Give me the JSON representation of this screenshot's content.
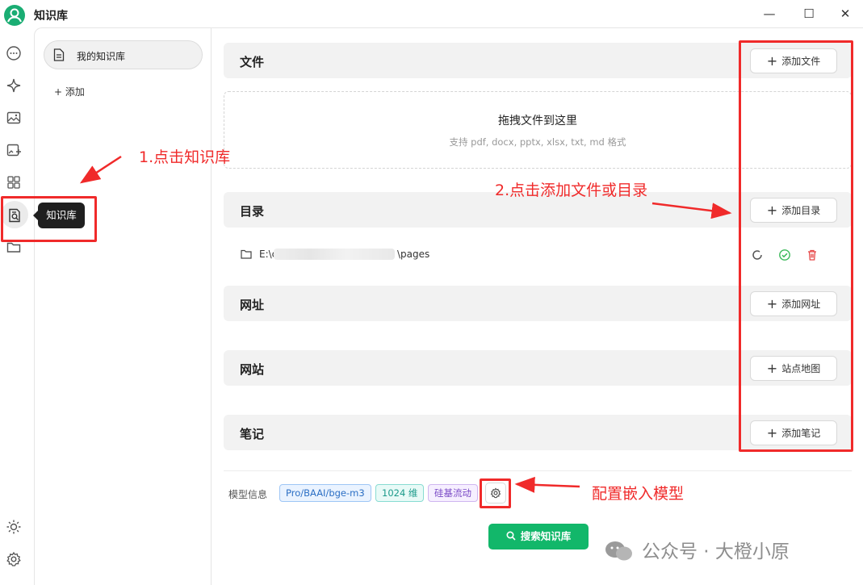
{
  "app": {
    "title": "知识库"
  },
  "window_controls": {
    "minimize": "—",
    "maximize": "☐",
    "close": "✕"
  },
  "rail": {
    "icons": [
      "chat-icon",
      "sparkle-icon",
      "image-icon",
      "image-edit-icon",
      "apps-grid-icon",
      "knowledge-base-icon",
      "folder-icon",
      "sun-icon",
      "settings-icon"
    ],
    "tooltip": "知识库"
  },
  "list_panel": {
    "items": [
      {
        "label": "我的知识库"
      }
    ],
    "add_label": "+ 添加"
  },
  "sections": {
    "files": {
      "title": "文件",
      "button": "添加文件"
    },
    "dropzone": {
      "title": "拖拽文件到这里",
      "subtitle": "支持 pdf, docx, pptx, xlsx, txt, md 格式"
    },
    "directory": {
      "title": "目录",
      "button": "添加目录",
      "path_prefix": "E:\\c",
      "path_suffix": "\\pages"
    },
    "url": {
      "title": "网址",
      "button": "添加网址"
    },
    "website": {
      "title": "网站",
      "button": "站点地图"
    },
    "notes": {
      "title": "笔记",
      "button": "添加笔记"
    }
  },
  "model_info": {
    "label": "模型信息",
    "tags": [
      "Pro/BAAI/bge-m3",
      "1024 维",
      "硅基流动"
    ]
  },
  "search_button": "搜索知识库",
  "annotations": {
    "step1": "1.点击知识库",
    "step2": "2.点击添加文件或目录",
    "step3": "配置嵌入模型"
  },
  "watermark": "公众号 · 大橙小原",
  "colors": {
    "accent": "#12b76a",
    "annotation": "#f02a2a"
  }
}
